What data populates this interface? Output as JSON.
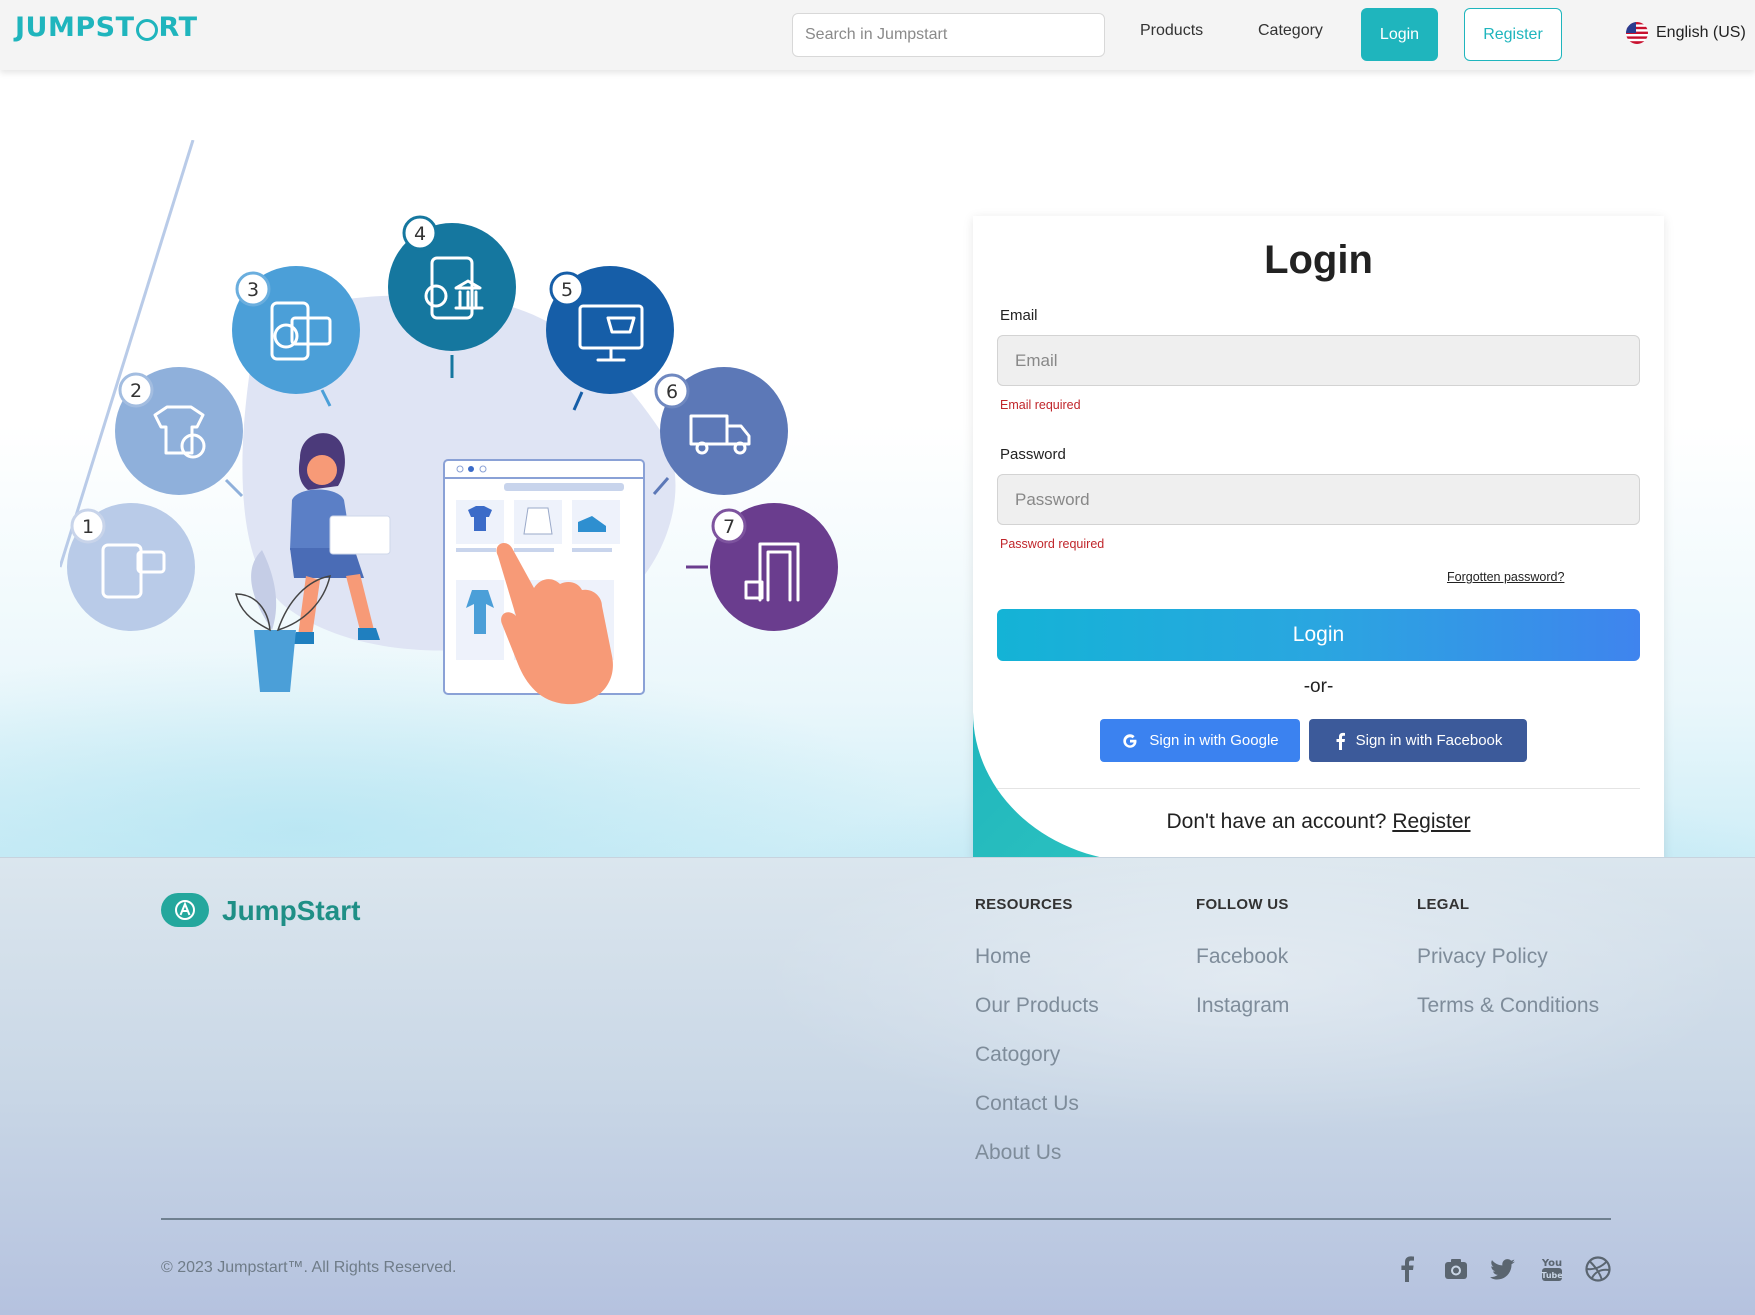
{
  "navbar": {
    "logo_left": "JUMPST",
    "logo_right": "RT",
    "search_placeholder": "Search in Jumpstart",
    "links": [
      "Products",
      "Category"
    ],
    "login_label": "Login",
    "register_label": "Register",
    "language": "English (US)"
  },
  "hero": {
    "steps": [
      "1",
      "2",
      "3",
      "4",
      "5",
      "6",
      "7"
    ],
    "step_colors": [
      "#b9cbe8",
      "#8fb0db",
      "#4b9fd8",
      "#15779f",
      "#165ea8",
      "#5c78b7",
      "#6a3d8e"
    ]
  },
  "login_form": {
    "title": "Login",
    "email_label": "Email",
    "email_placeholder": "Email",
    "email_error": "Email required",
    "password_label": "Password",
    "password_placeholder": "Password",
    "password_error": "Password required",
    "forgot_password": "Forgotten password?",
    "submit_label": "Login",
    "or_text": "-or-",
    "google_label": "Sign in with Google",
    "facebook_label": "Sign in with Facebook",
    "no_account_text": "Don't have an account?",
    "register_link": "Register"
  },
  "footer": {
    "brand": "JumpStart",
    "resources": {
      "heading": "RESOURCES",
      "links": [
        "Home",
        "Our Products",
        "Catogory",
        "Contact Us",
        "About Us"
      ]
    },
    "follow_us": {
      "heading": "FOLLOW US",
      "links": [
        "Facebook",
        "Instagram"
      ]
    },
    "legal": {
      "heading": "LEGAL",
      "links": [
        "Privacy Policy",
        "Terms & Conditions"
      ]
    },
    "copyright": "© 2023 Jumpstart™. All Rights Reserved.",
    "social_icons": [
      "facebook-icon",
      "instagram-icon",
      "twitter-icon",
      "youtube-icon",
      "dribbble-icon"
    ]
  },
  "colors": {
    "brand_teal": "#1fb5bd",
    "error_red": "#c0262b",
    "google_blue": "#3b82f0",
    "facebook_blue": "#3c5a9a"
  }
}
